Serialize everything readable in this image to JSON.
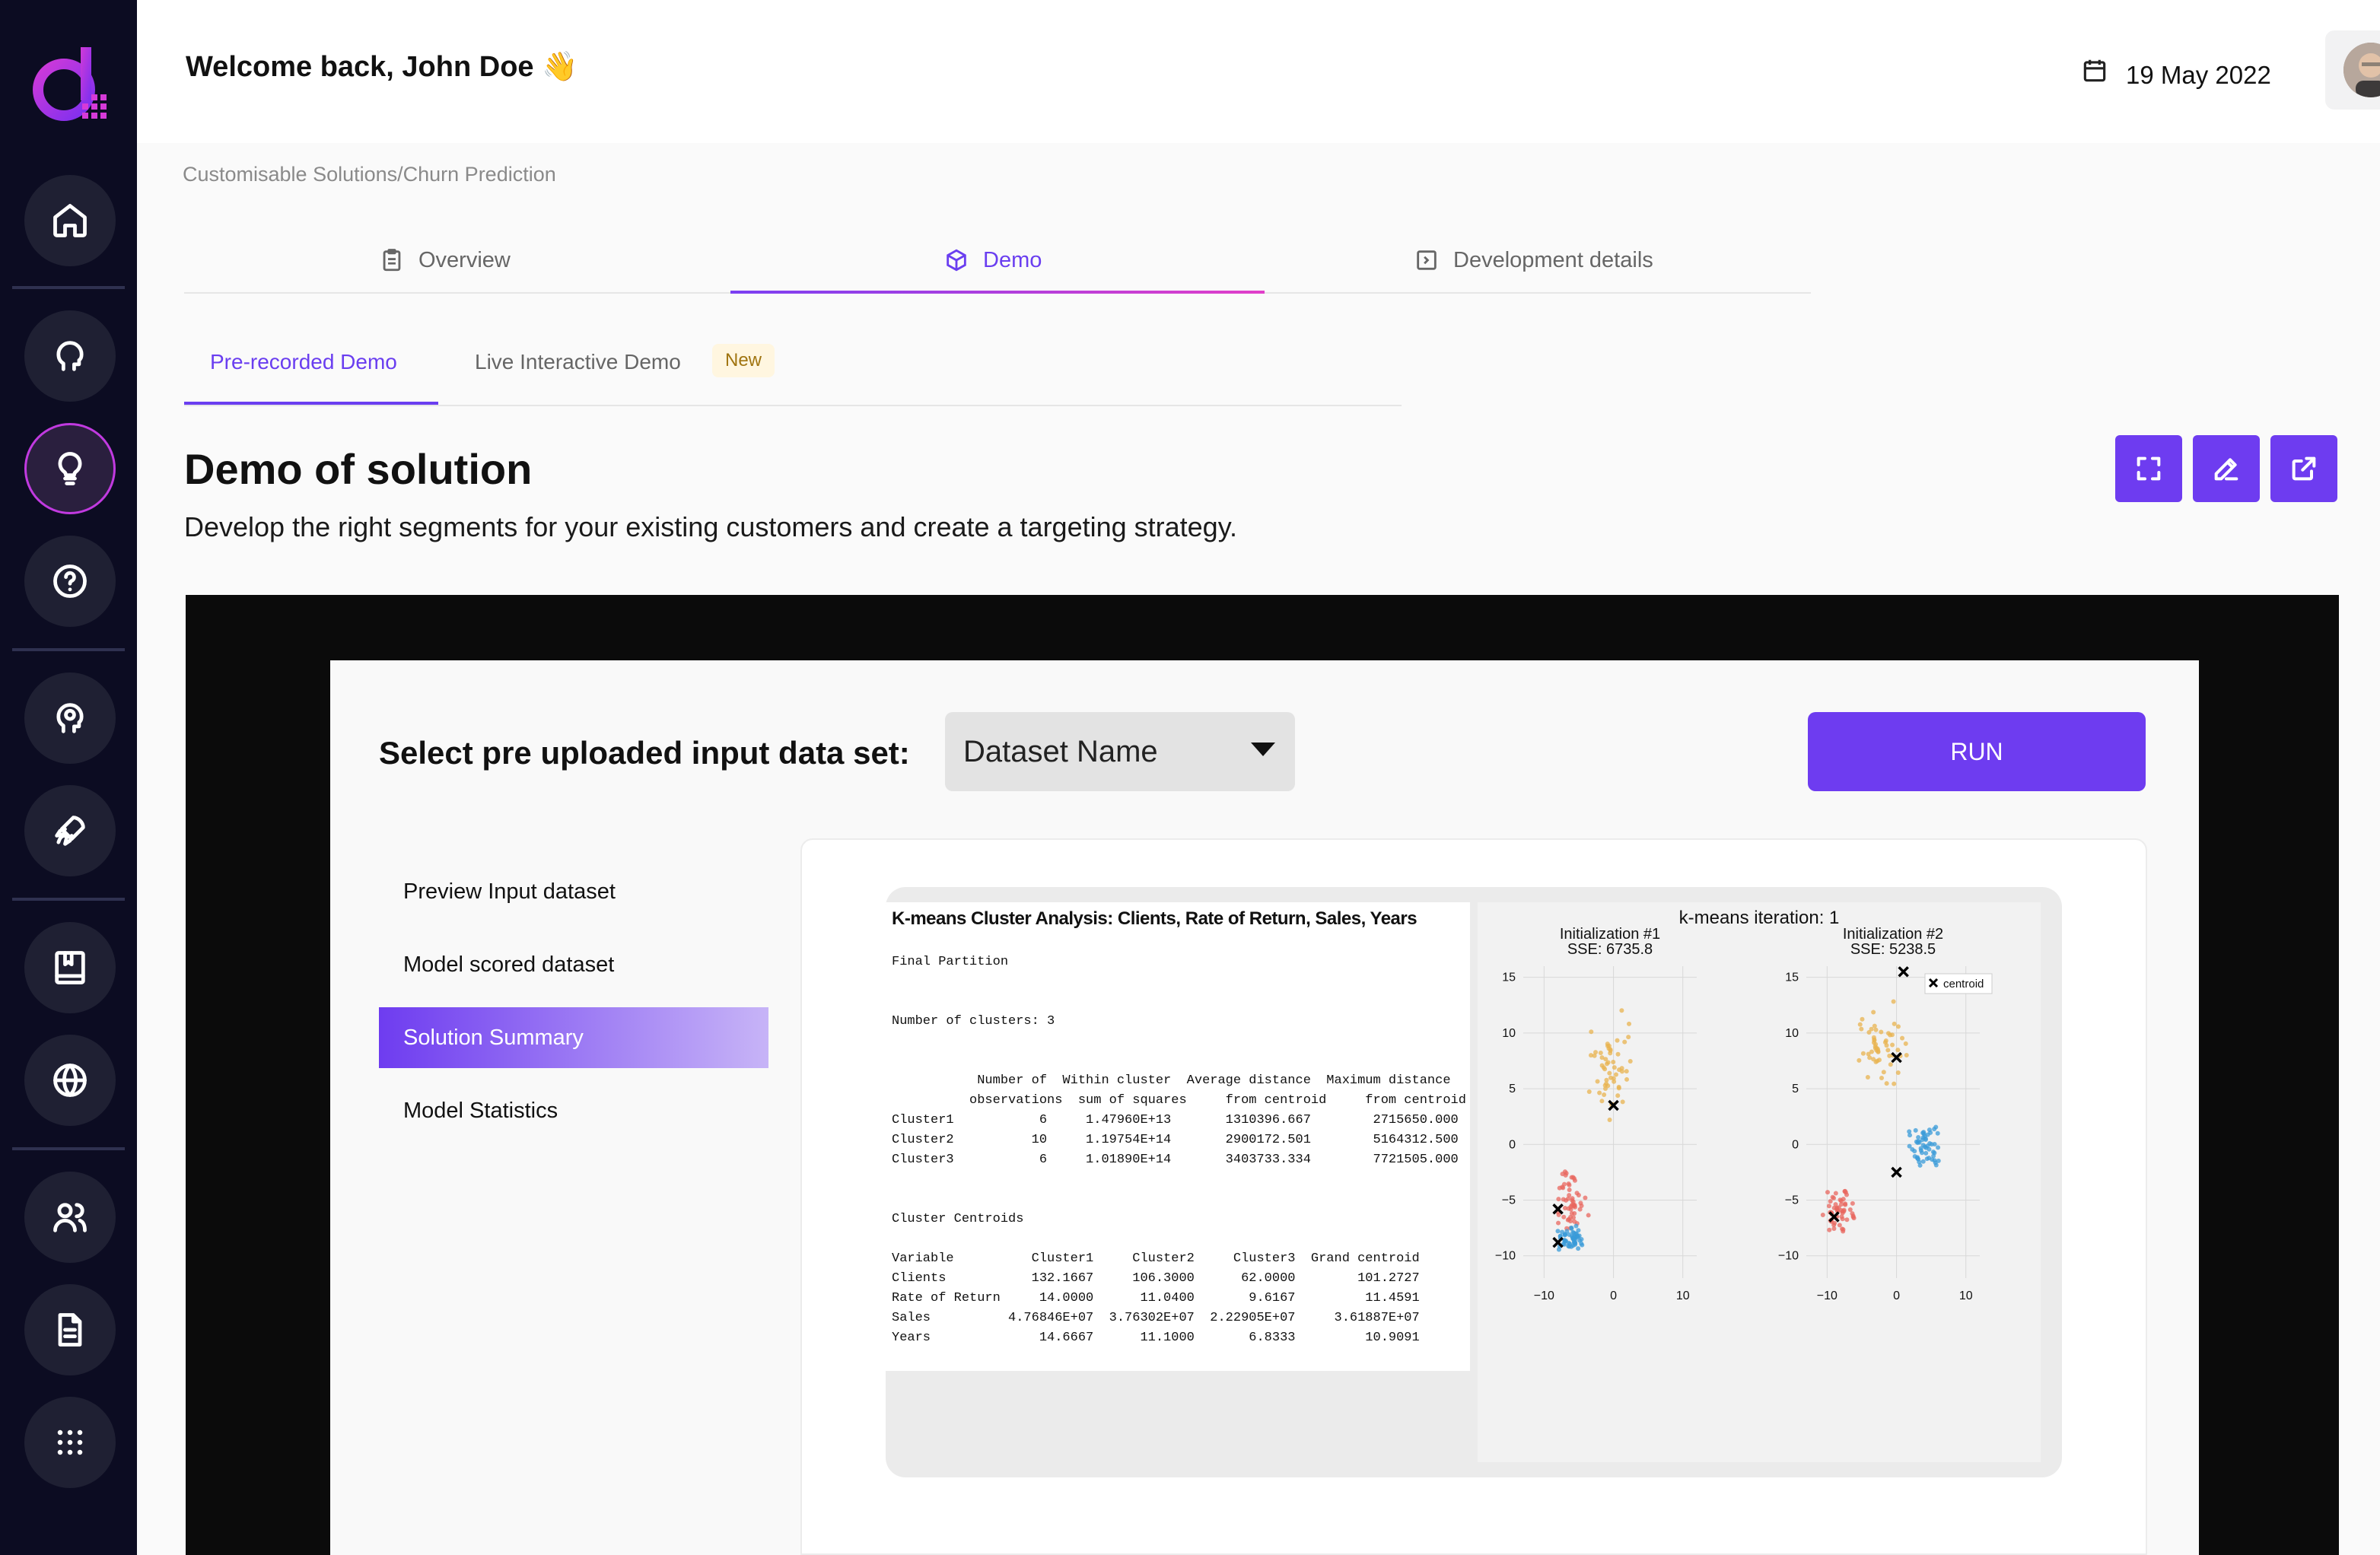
{
  "header": {
    "welcome": "Welcome back, John Doe 👋",
    "date": "19 May 2022",
    "icons": {
      "calendar": "calendar-icon",
      "user_menu": "chevron-down-icon"
    }
  },
  "sidebar": {
    "items": [
      {
        "name": "home",
        "icon": "home-icon"
      },
      {
        "name": "ai-head",
        "icon": "head-icon"
      },
      {
        "name": "ideas",
        "icon": "lightbulb-icon",
        "active": true
      },
      {
        "name": "help",
        "icon": "question-icon"
      },
      {
        "name": "insights",
        "icon": "head-bulb-icon"
      },
      {
        "name": "launch",
        "icon": "rocket-icon"
      },
      {
        "name": "library",
        "icon": "book-icon"
      },
      {
        "name": "global",
        "icon": "globe-icon"
      },
      {
        "name": "users",
        "icon": "users-icon"
      },
      {
        "name": "documents",
        "icon": "document-icon"
      },
      {
        "name": "apps",
        "icon": "grid-icon"
      }
    ]
  },
  "breadcrumb": "Customisable Solutions/Churn Prediction",
  "tabs": [
    {
      "label": "Overview",
      "icon": "clipboard-icon",
      "active": false
    },
    {
      "label": "Demo",
      "icon": "cube-icon",
      "active": true
    },
    {
      "label": "Development details",
      "icon": "code-icon",
      "active": false
    }
  ],
  "subtabs": [
    {
      "label": "Pre-recorded Demo",
      "active": true
    },
    {
      "label": "Live Interactive Demo",
      "active": false,
      "badge": "New"
    }
  ],
  "page": {
    "title": "Demo of solution",
    "description": "Develop the right segments for your existing customers and create a targeting strategy.",
    "actions": [
      "fullscreen-icon",
      "edit-icon",
      "external-link-icon"
    ]
  },
  "demo": {
    "select_label": "Select pre uploaded input data set:",
    "dataset_value": "Dataset Name",
    "run_label": "RUN",
    "menu": [
      {
        "label": "Preview Input dataset",
        "active": false
      },
      {
        "label": "Model scored dataset",
        "active": false
      },
      {
        "label": "Solution Summary",
        "active": true
      },
      {
        "label": "Model Statistics",
        "active": false
      }
    ]
  },
  "report": {
    "title": "K-means Cluster Analysis: Clients, Rate of Return, Sales, Years",
    "final_partition": "Final Partition",
    "num_clusters": "Number of clusters: 3",
    "table_header": "           Number of  Within cluster  Average distance  Maximum distance\n          observations  sum of squares     from centroid     from centroid",
    "table_rows": "Cluster1           6     1.47960E+13       1310396.667        2715650.000\nCluster2          10     1.19754E+14       2900172.501        5164312.500\nCluster3           6     1.01890E+14       3403733.334        7721505.000",
    "centroids_title": "Cluster Centroids",
    "centroids": "Variable          Cluster1     Cluster2     Cluster3  Grand centroid\nClients           132.1667     106.3000      62.0000        101.2727\nRate of Return     14.0000      11.0400       9.6167         11.4591\nSales          4.76846E+07  3.76302E+07  2.22905E+07     3.61887E+07\nYears              14.6667      11.1000       6.8333         10.9091"
  },
  "chart_data": {
    "type": "scatter",
    "title": "k-means iteration: 1",
    "legend": "centroid",
    "panels": [
      {
        "title": "Initialization #1",
        "subtitle": "SSE: 6735.8",
        "xticks": [
          -10,
          0,
          10
        ],
        "yticks": [
          15,
          10,
          5,
          0,
          -5,
          -10
        ],
        "xlim": [
          -13,
          12
        ],
        "ylim": [
          -12,
          16
        ],
        "centroids": [
          [
            0,
            3.5
          ],
          [
            -8,
            -5.8
          ],
          [
            -8,
            -8.8
          ]
        ],
        "clusters": [
          {
            "color": "#e8b34f",
            "center": [
              0,
              7
            ],
            "spread": [
              4.5,
              6
            ]
          },
          {
            "color": "#e8675f",
            "center": [
              -6,
              -5
            ],
            "spread": [
              3,
              3.5
            ]
          },
          {
            "color": "#3a9bd8",
            "center": [
              -6,
              -8.5
            ],
            "spread": [
              2.5,
              1.5
            ]
          }
        ]
      },
      {
        "title": "Initialization #2",
        "subtitle": "SSE: 5238.5",
        "xticks": [
          -10,
          0,
          10
        ],
        "yticks": [
          15,
          10,
          5,
          0,
          -5,
          -10
        ],
        "xlim": [
          -13,
          12
        ],
        "ylim": [
          -12,
          16
        ],
        "centroids": [
          [
            1,
            15.5
          ],
          [
            0,
            7.8
          ],
          [
            0,
            -2.5
          ],
          [
            -9,
            -6.5
          ]
        ],
        "clusters": [
          {
            "color": "#e8b34f",
            "center": [
              -2,
              9
            ],
            "spread": [
              4.5,
              5
            ]
          },
          {
            "color": "#3a9bd8",
            "center": [
              4,
              0
            ],
            "spread": [
              3,
              3
            ]
          },
          {
            "color": "#e8675f",
            "center": [
              -8,
              -6
            ],
            "spread": [
              3,
              3
            ]
          }
        ]
      }
    ]
  }
}
